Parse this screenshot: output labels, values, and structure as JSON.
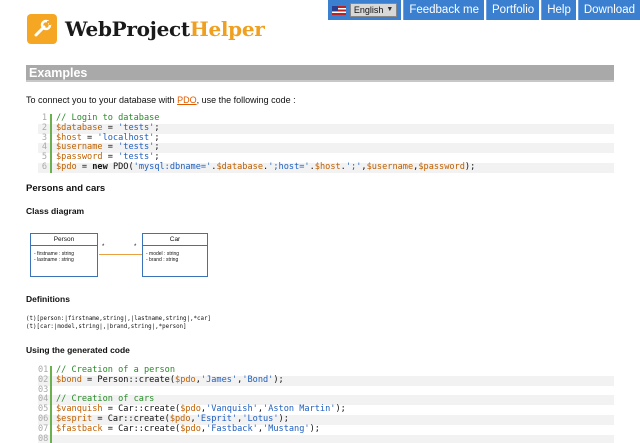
{
  "header": {
    "logo_text_a": "WebProject",
    "logo_text_b": "Helper"
  },
  "topnav": {
    "language": "English",
    "items": [
      "Feedback me",
      "Portfolio",
      "Help",
      "Download"
    ]
  },
  "section": {
    "title": "Examples"
  },
  "intro": {
    "before": "To connect you to your database with ",
    "link": "PDO",
    "after": ", use the following code :"
  },
  "code1": [
    {
      "ln": "1",
      "parts": [
        [
          "c-com",
          "// Login to database"
        ]
      ]
    },
    {
      "ln": "2",
      "parts": [
        [
          "c-var",
          "$database"
        ],
        [
          "c-op",
          " = "
        ],
        [
          "c-str",
          "'tests'"
        ],
        [
          "c-op",
          ";"
        ]
      ]
    },
    {
      "ln": "3",
      "parts": [
        [
          "c-var",
          "$host"
        ],
        [
          "c-op",
          " = "
        ],
        [
          "c-str",
          "'localhost'"
        ],
        [
          "c-op",
          ";"
        ]
      ]
    },
    {
      "ln": "4",
      "parts": [
        [
          "c-var",
          "$username"
        ],
        [
          "c-op",
          " = "
        ],
        [
          "c-str",
          "'tests'"
        ],
        [
          "c-op",
          ";"
        ]
      ]
    },
    {
      "ln": "5",
      "parts": [
        [
          "c-var",
          "$password"
        ],
        [
          "c-op",
          " = "
        ],
        [
          "c-str",
          "'tests'"
        ],
        [
          "c-op",
          ";"
        ]
      ]
    },
    {
      "ln": "6",
      "parts": [
        [
          "c-var",
          "$pdo"
        ],
        [
          "c-op",
          " = "
        ],
        [
          "c-kw",
          "new"
        ],
        [
          "c-op",
          " PDO("
        ],
        [
          "c-str",
          "'mysql:dbname='"
        ],
        [
          "c-op",
          "."
        ],
        [
          "c-var",
          "$database"
        ],
        [
          "c-op",
          "."
        ],
        [
          "c-str",
          "';host='"
        ],
        [
          "c-op",
          "."
        ],
        [
          "c-var",
          "$host"
        ],
        [
          "c-op",
          "."
        ],
        [
          "c-str",
          "';'"
        ],
        [
          "c-op",
          ","
        ],
        [
          "c-var",
          "$username"
        ],
        [
          "c-op",
          ","
        ],
        [
          "c-var",
          "$password"
        ],
        [
          "c-op",
          ");"
        ]
      ]
    }
  ],
  "persons_title": "Persons and cars",
  "class_diagram_title": "Class diagram",
  "diagram": {
    "person": {
      "name": "Person",
      "attrs": [
        "- firstname : string",
        "- lastname : string"
      ]
    },
    "car": {
      "name": "Car",
      "attrs": [
        "- model : string",
        "- brand : string"
      ]
    },
    "mult_left": "*",
    "mult_right": "*"
  },
  "definitions_title": "Definitions",
  "definitions": "(t)[person:|firstname,string|,|lastname,string|,*car]\n(t)[car:|model,string|,|brand,string|,*person]",
  "generated_title": "Using the generated code",
  "code2": [
    {
      "ln": "01",
      "parts": [
        [
          "c-com",
          "// Creation of a person"
        ]
      ]
    },
    {
      "ln": "02",
      "parts": [
        [
          "c-var",
          "$bond"
        ],
        [
          "c-op",
          " = Person::create("
        ],
        [
          "c-var",
          "$pdo"
        ],
        [
          "c-op",
          ","
        ],
        [
          "c-str",
          "'James'"
        ],
        [
          "c-op",
          ","
        ],
        [
          "c-str",
          "'Bond'"
        ],
        [
          "c-op",
          ");"
        ]
      ]
    },
    {
      "ln": "03",
      "parts": [
        [
          "c-op",
          ""
        ]
      ]
    },
    {
      "ln": "04",
      "parts": [
        [
          "c-com",
          "// Creation of cars"
        ]
      ]
    },
    {
      "ln": "05",
      "parts": [
        [
          "c-var",
          "$vanquish"
        ],
        [
          "c-op",
          " = Car::create("
        ],
        [
          "c-var",
          "$pdo"
        ],
        [
          "c-op",
          ","
        ],
        [
          "c-str",
          "'Vanquish'"
        ],
        [
          "c-op",
          ","
        ],
        [
          "c-str",
          "'Aston Martin'"
        ],
        [
          "c-op",
          ");"
        ]
      ]
    },
    {
      "ln": "06",
      "parts": [
        [
          "c-var",
          "$esprit"
        ],
        [
          "c-op",
          " = Car::create("
        ],
        [
          "c-var",
          "$pdo"
        ],
        [
          "c-op",
          ","
        ],
        [
          "c-str",
          "'Esprit'"
        ],
        [
          "c-op",
          ","
        ],
        [
          "c-str",
          "'Lotus'"
        ],
        [
          "c-op",
          ");"
        ]
      ]
    },
    {
      "ln": "07",
      "parts": [
        [
          "c-var",
          "$fastback"
        ],
        [
          "c-op",
          " = Car::create("
        ],
        [
          "c-var",
          "$pdo"
        ],
        [
          "c-op",
          ","
        ],
        [
          "c-str",
          "'Fastback'"
        ],
        [
          "c-op",
          ","
        ],
        [
          "c-str",
          "'Mustang'"
        ],
        [
          "c-op",
          ");"
        ]
      ]
    },
    {
      "ln": "08",
      "parts": [
        [
          "c-op",
          ""
        ]
      ]
    }
  ]
}
